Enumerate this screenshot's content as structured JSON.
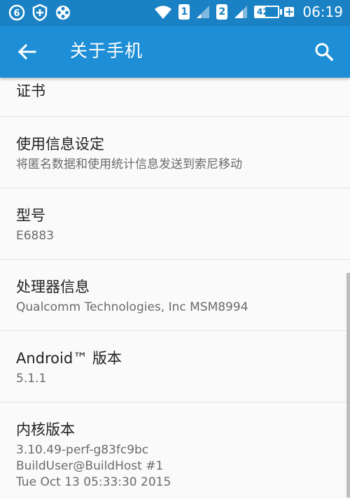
{
  "status_bar": {
    "icons_left": [
      "app-icon-6",
      "shield-icon",
      "film-reel-icon"
    ],
    "wifi": "wifi-icon",
    "sim1_label": "1",
    "sim2_label": "2",
    "battery_percent": 42,
    "battery_text": "42%",
    "charging": true,
    "time": "06:19"
  },
  "app_bar": {
    "title": "关于手机",
    "back_icon": "arrow-back-icon",
    "search_icon": "search-icon",
    "color": "#1e8fd6"
  },
  "items": [
    {
      "title": "证书"
    },
    {
      "title": "使用信息设定",
      "subtitle": "将匿名数据和使用统计信息发送到索尼移动"
    },
    {
      "title": "型号",
      "subtitle": "E6883"
    },
    {
      "title": "处理器信息",
      "subtitle": "Qualcomm Technologies, Inc MSM8994"
    },
    {
      "title": "Android™ 版本",
      "subtitle": "5.1.1"
    },
    {
      "title": "内核版本",
      "subtitle_lines": [
        "3.10.49-perf-g83fc9bc",
        "BuildUser@BuildHost #1",
        "Tue Oct 13 05:33:30 2015"
      ]
    }
  ]
}
